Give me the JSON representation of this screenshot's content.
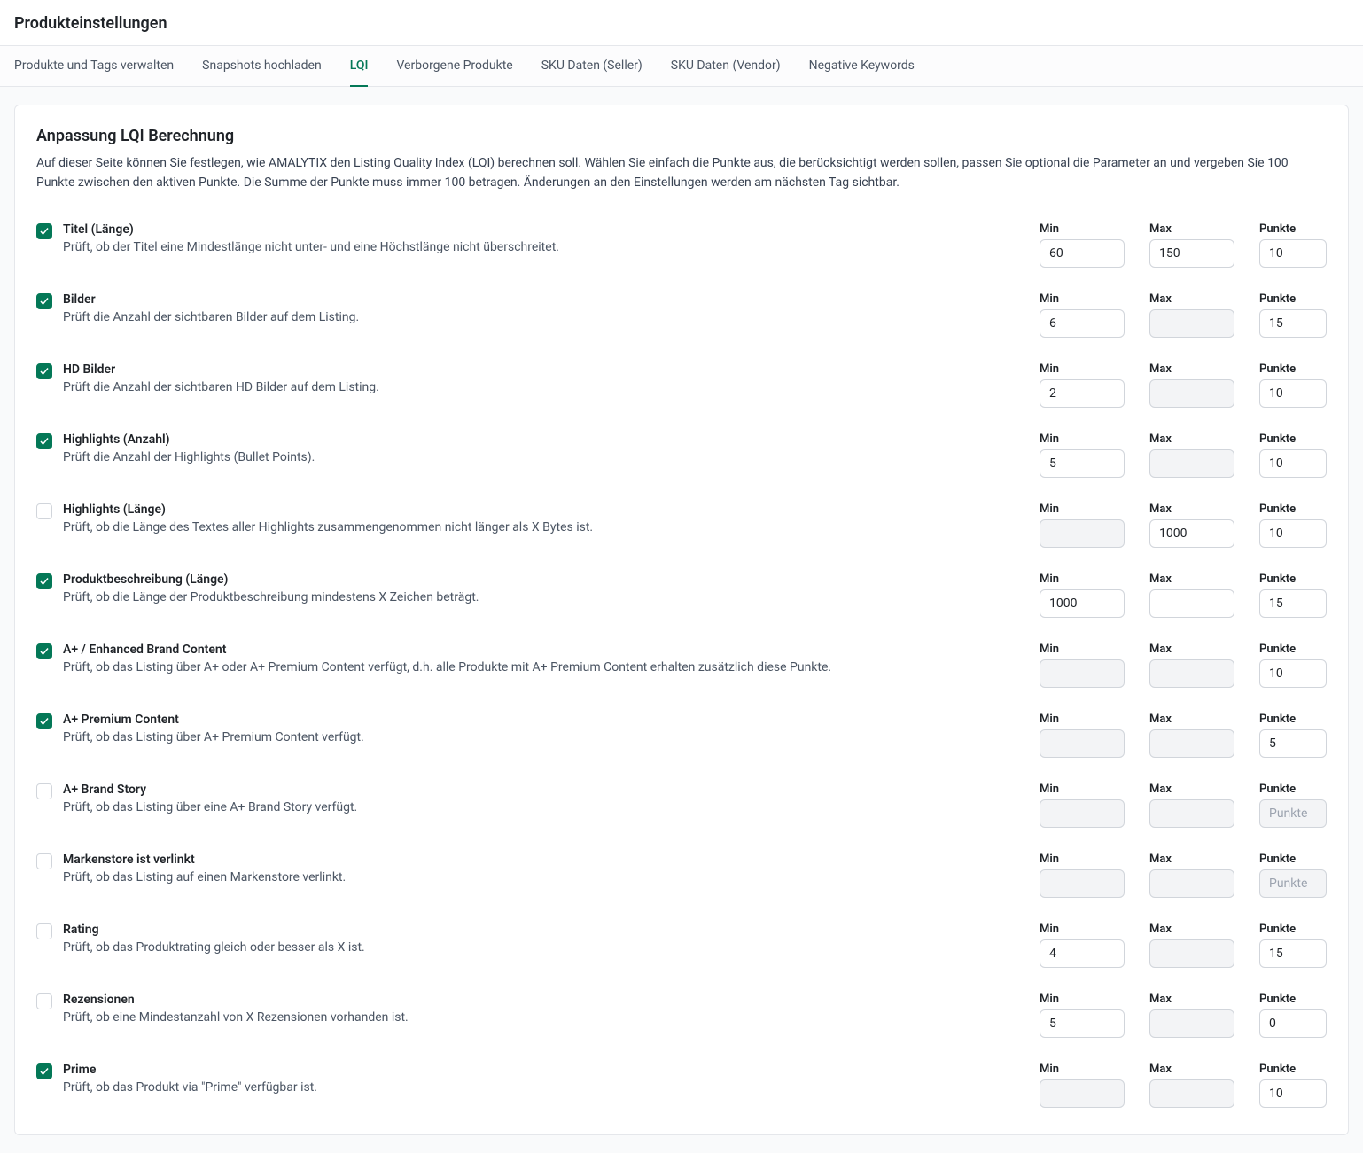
{
  "page": {
    "title": "Produkteinstellungen"
  },
  "tabs": [
    {
      "label": "Produkte und Tags verwalten",
      "active": false
    },
    {
      "label": "Snapshots hochladen",
      "active": false
    },
    {
      "label": "LQI",
      "active": true
    },
    {
      "label": "Verborgene Produkte",
      "active": false
    },
    {
      "label": "SKU Daten (Seller)",
      "active": false
    },
    {
      "label": "SKU Daten (Vendor)",
      "active": false
    },
    {
      "label": "Negative Keywords",
      "active": false
    }
  ],
  "card": {
    "title": "Anpassung LQI Berechnung",
    "desc": "Auf dieser Seite können Sie festlegen, wie AMALYTIX den Listing Quality Index (LQI) berechnen soll. Wählen Sie einfach die Punkte aus, die berücksichtigt werden sollen, passen Sie optional die Parameter an und vergeben Sie 100 Punkte zwischen den aktiven Punkte. Die Summe der Punkte muss immer 100 betragen. Änderungen an den Einstellungen werden am nächsten Tag sichtbar."
  },
  "headers": {
    "min": "Min",
    "max": "Max",
    "punkte": "Punkte"
  },
  "punkte_placeholder": "Punkte",
  "rows": [
    {
      "checked": true,
      "title": "Titel (Länge)",
      "desc": "Prüft, ob der Titel eine Mindestlänge nicht unter- und eine Höchstlänge nicht überschreitet.",
      "min": "60",
      "min_disabled": false,
      "max": "150",
      "max_disabled": false,
      "punkte": "10",
      "punkte_disabled": false
    },
    {
      "checked": true,
      "title": "Bilder",
      "desc": "Prüft die Anzahl der sichtbaren Bilder auf dem Listing.",
      "min": "6",
      "min_disabled": false,
      "max": "",
      "max_disabled": true,
      "punkte": "15",
      "punkte_disabled": false
    },
    {
      "checked": true,
      "title": "HD Bilder",
      "desc": "Prüft die Anzahl der sichtbaren HD Bilder auf dem Listing.",
      "min": "2",
      "min_disabled": false,
      "max": "",
      "max_disabled": true,
      "punkte": "10",
      "punkte_disabled": false
    },
    {
      "checked": true,
      "title": "Highlights (Anzahl)",
      "desc": "Prüft die Anzahl der Highlights (Bullet Points).",
      "min": "5",
      "min_disabled": false,
      "max": "",
      "max_disabled": true,
      "punkte": "10",
      "punkte_disabled": false
    },
    {
      "checked": false,
      "title": "Highlights (Länge)",
      "desc": "Prüft, ob die Länge des Textes aller Highlights zusammengenommen nicht länger als X Bytes ist.",
      "min": "",
      "min_disabled": true,
      "max": "1000",
      "max_disabled": false,
      "punkte": "10",
      "punkte_disabled": false
    },
    {
      "checked": true,
      "title": "Produktbeschreibung (Länge)",
      "desc": "Prüft, ob die Länge der Produktbeschreibung mindestens X Zeichen beträgt.",
      "min": "1000",
      "min_disabled": false,
      "max": "",
      "max_disabled": false,
      "punkte": "15",
      "punkte_disabled": false
    },
    {
      "checked": true,
      "title": "A+ / Enhanced Brand Content",
      "desc": "Prüft, ob das Listing über A+ oder A+ Premium Content verfügt, d.h. alle Produkte mit A+ Premium Content erhalten zusätzlich diese Punkte.",
      "min": "",
      "min_disabled": true,
      "max": "",
      "max_disabled": true,
      "punkte": "10",
      "punkte_disabled": false
    },
    {
      "checked": true,
      "title": "A+ Premium Content",
      "desc": "Prüft, ob das Listing über A+ Premium Content verfügt.",
      "min": "",
      "min_disabled": true,
      "max": "",
      "max_disabled": true,
      "punkte": "5",
      "punkte_disabled": false
    },
    {
      "checked": false,
      "title": "A+ Brand Story",
      "desc": "Prüft, ob das Listing über eine A+ Brand Story verfügt.",
      "min": "",
      "min_disabled": true,
      "max": "",
      "max_disabled": true,
      "punkte": "",
      "punkte_disabled": true
    },
    {
      "checked": false,
      "title": "Markenstore ist verlinkt",
      "desc": "Prüft, ob das Listing auf einen Markenstore verlinkt.",
      "min": "",
      "min_disabled": true,
      "max": "",
      "max_disabled": true,
      "punkte": "",
      "punkte_disabled": true
    },
    {
      "checked": false,
      "title": "Rating",
      "desc": "Prüft, ob das Produktrating gleich oder besser als X ist.",
      "min": "4",
      "min_disabled": false,
      "max": "",
      "max_disabled": true,
      "punkte": "15",
      "punkte_disabled": false
    },
    {
      "checked": false,
      "title": "Rezensionen",
      "desc": "Prüft, ob eine Mindestanzahl von X Rezensionen vorhanden ist.",
      "min": "5",
      "min_disabled": false,
      "max": "",
      "max_disabled": true,
      "punkte": "0",
      "punkte_disabled": false
    },
    {
      "checked": true,
      "title": "Prime",
      "desc": "Prüft, ob das Produkt via \"Prime\" verfügbar ist.",
      "min": "",
      "min_disabled": true,
      "max": "",
      "max_disabled": true,
      "punkte": "10",
      "punkte_disabled": false
    }
  ]
}
